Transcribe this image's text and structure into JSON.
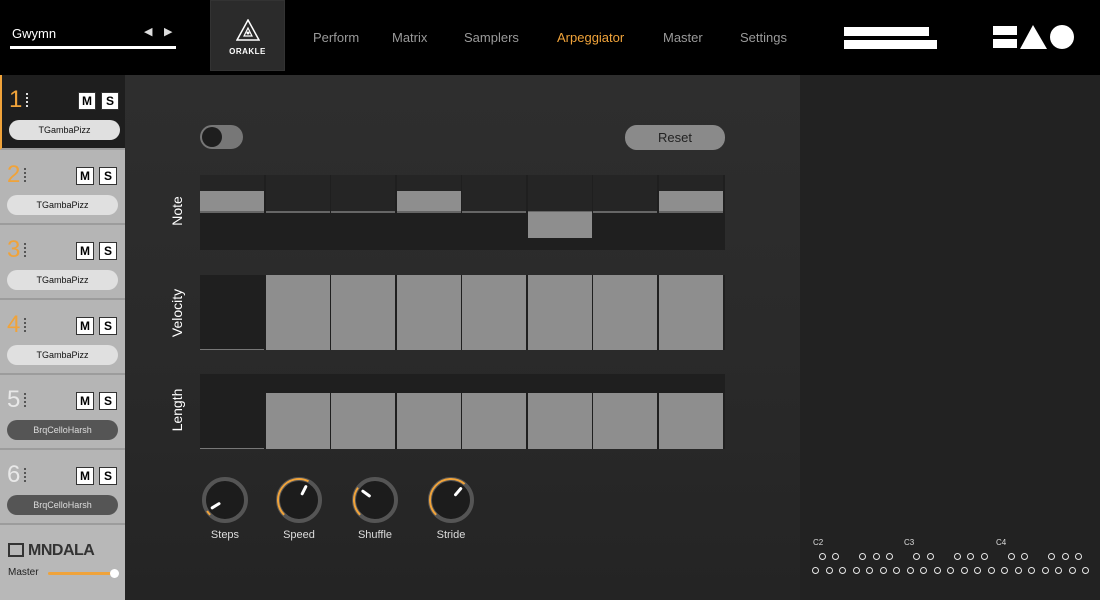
{
  "header": {
    "preset_name": "Gwymn",
    "prev_glyph": "◀",
    "next_glyph": "▶",
    "logo_text": "ORAKLE",
    "nav": [
      {
        "label": "Perform",
        "active": false
      },
      {
        "label": "Matrix",
        "active": false
      },
      {
        "label": "Samplers",
        "active": false
      },
      {
        "label": "Arpeggiator",
        "active": true
      },
      {
        "label": "Master",
        "active": false
      },
      {
        "label": "Settings",
        "active": false
      }
    ]
  },
  "tracks": [
    {
      "num": "1",
      "mute": "M",
      "solo": "S",
      "sample": "TGambaPizz",
      "active": true,
      "dim": false
    },
    {
      "num": "2",
      "mute": "M",
      "solo": "S",
      "sample": "TGambaPizz",
      "active": false,
      "dim": false
    },
    {
      "num": "3",
      "mute": "M",
      "solo": "S",
      "sample": "TGambaPizz",
      "active": false,
      "dim": false
    },
    {
      "num": "4",
      "mute": "M",
      "solo": "S",
      "sample": "TGambaPizz",
      "active": false,
      "dim": false
    },
    {
      "num": "5",
      "mute": "M",
      "solo": "S",
      "sample": "BrqCelloHarsh",
      "active": false,
      "dim": true
    },
    {
      "num": "6",
      "mute": "M",
      "solo": "S",
      "sample": "BrqCelloHarsh",
      "active": false,
      "dim": true
    }
  ],
  "sidebar_footer": {
    "brand": "MNDALA",
    "master_label": "Master",
    "master_level": 1.0
  },
  "arpeggiator": {
    "enabled": false,
    "reset_label": "Reset",
    "note_label": "Note",
    "velocity_label": "Velocity",
    "length_label": "Length",
    "note_steps": [
      1,
      0,
      0,
      1,
      0,
      -1,
      0,
      1
    ],
    "velocity_steps": [
      0,
      1,
      1,
      1,
      1,
      1,
      1,
      1
    ],
    "length_steps": [
      0,
      0.75,
      0.75,
      0.75,
      0.75,
      0.75,
      0.75,
      0.75
    ],
    "knobs": [
      {
        "label": "Steps",
        "value": 0.05
      },
      {
        "label": "Speed",
        "value": 0.6
      },
      {
        "label": "Shuffle",
        "value": 0.3
      },
      {
        "label": "Stride",
        "value": 0.65
      }
    ]
  },
  "keyboard": {
    "octave_labels": [
      "C2",
      "C3",
      "C4"
    ]
  },
  "colors": {
    "accent": "#f0a33a"
  }
}
